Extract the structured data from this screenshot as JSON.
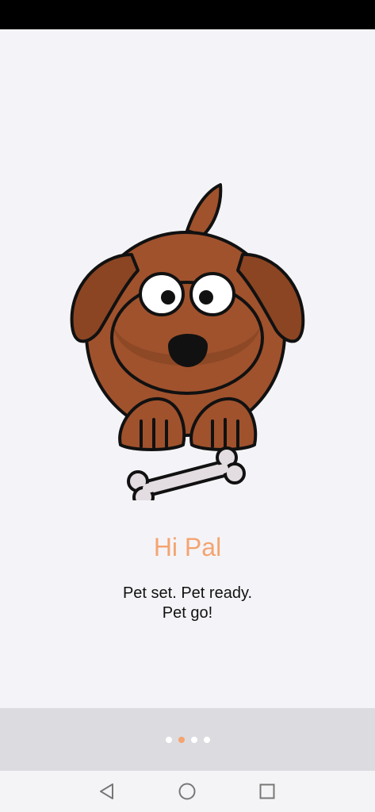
{
  "onboarding": {
    "title": "Hi Pal",
    "subtitle_line1": "Pet set. Pet ready.",
    "subtitle_line2": "Pet go!",
    "current_page": 2,
    "page_count": 4
  },
  "illustration": {
    "name": "dog-with-bone",
    "colors": {
      "fur": "#a0522d",
      "fur_dark": "#7a3e1f",
      "bone": "#e3dde2",
      "outline": "#111111"
    }
  },
  "theme": {
    "accent": "#f4a470",
    "background": "#f4f4f8",
    "pager_background": "#dcdce0"
  },
  "nav": {
    "back_icon": "back-triangle-icon",
    "home_icon": "home-circle-icon",
    "recents_icon": "recents-square-icon"
  }
}
